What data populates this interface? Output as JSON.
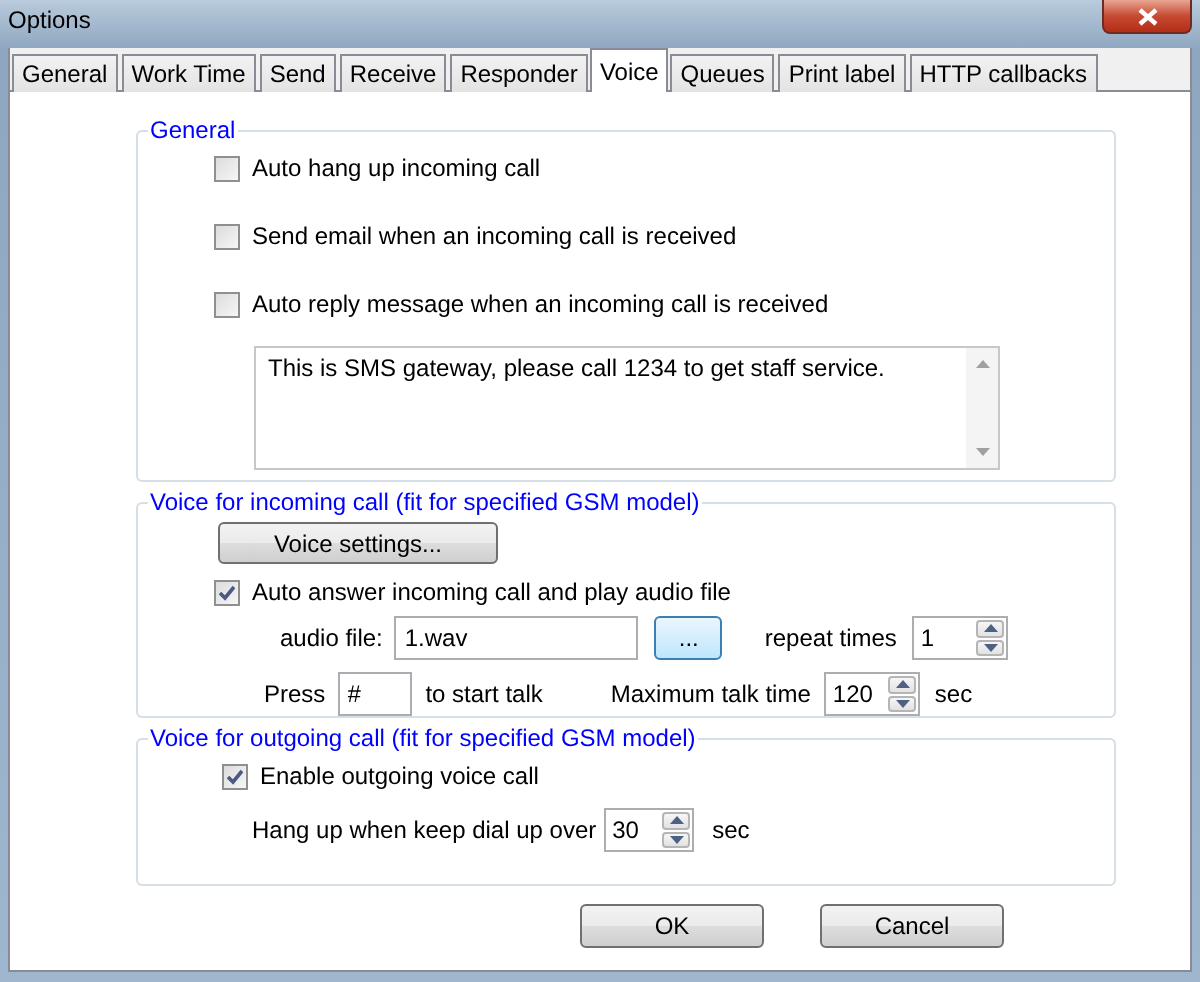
{
  "window": {
    "title": "Options"
  },
  "tabs": [
    {
      "label": "General",
      "selected": false
    },
    {
      "label": "Work Time",
      "selected": false
    },
    {
      "label": "Send",
      "selected": false
    },
    {
      "label": "Receive",
      "selected": false
    },
    {
      "label": "Responder",
      "selected": false
    },
    {
      "label": "Voice",
      "selected": true
    },
    {
      "label": "Queues",
      "selected": false
    },
    {
      "label": "Print label",
      "selected": false
    },
    {
      "label": "HTTP callbacks",
      "selected": false
    }
  ],
  "general": {
    "title": "General",
    "options": [
      {
        "label": "Auto hang up incoming call",
        "checked": false
      },
      {
        "label": "Send email when an incoming call is received",
        "checked": false
      },
      {
        "label": "Auto reply message when an incoming call is received",
        "checked": false
      }
    ],
    "message": "This is SMS gateway, please call 1234 to get staff service."
  },
  "incoming": {
    "title": "Voice for incoming call (fit for specified GSM model)",
    "settings_button": "Voice settings...",
    "auto_answer": {
      "label": "Auto answer incoming call and play audio file",
      "checked": true
    },
    "audio_file_label": "audio file:",
    "audio_file": "1.wav",
    "browse_button": "...",
    "repeat_label": "repeat times",
    "repeat": "1",
    "press_label": "Press",
    "press_key": "#",
    "start_label": "to start talk",
    "max_label": "Maximum talk time",
    "max_time": "120",
    "sec": "sec"
  },
  "outgoing": {
    "title": "Voice for outgoing call (fit for specified GSM model)",
    "enable": {
      "label": "Enable outgoing voice call",
      "checked": true
    },
    "hangup_label": "Hang up when keep dial up over",
    "hangup_time": "30",
    "sec": "sec"
  },
  "buttons": [
    {
      "label": "OK"
    },
    {
      "label": "Cancel"
    }
  ]
}
